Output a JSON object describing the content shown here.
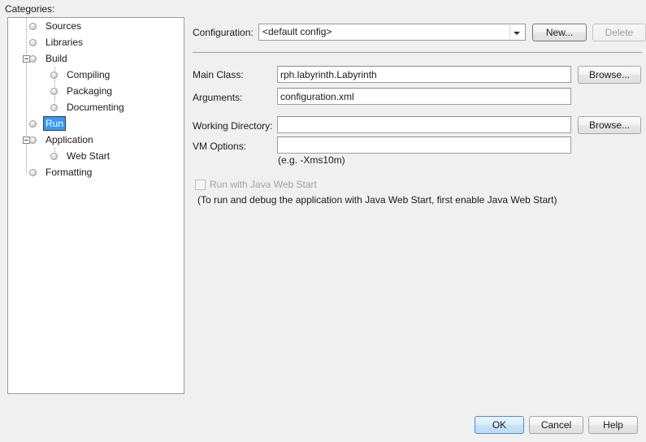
{
  "categories": {
    "label": "Categories:",
    "items": [
      {
        "label": "Sources",
        "depth": 1,
        "icon": "sphere-node-icon",
        "expander": "none",
        "selected": false
      },
      {
        "label": "Libraries",
        "depth": 1,
        "icon": "sphere-node-icon",
        "expander": "none",
        "selected": false
      },
      {
        "label": "Build",
        "depth": 1,
        "icon": "sphere-node-icon",
        "expander": "minus",
        "selected": false
      },
      {
        "label": "Compiling",
        "depth": 2,
        "icon": "sphere-node-icon",
        "expander": "none",
        "selected": false
      },
      {
        "label": "Packaging",
        "depth": 2,
        "icon": "sphere-node-icon",
        "expander": "none",
        "selected": false
      },
      {
        "label": "Documenting",
        "depth": 2,
        "icon": "sphere-node-icon",
        "expander": "none",
        "selected": false
      },
      {
        "label": "Run",
        "depth": 1,
        "icon": "sphere-node-icon",
        "expander": "none",
        "selected": true
      },
      {
        "label": "Application",
        "depth": 1,
        "icon": "sphere-node-icon",
        "expander": "minus",
        "selected": false
      },
      {
        "label": "Web Start",
        "depth": 2,
        "icon": "sphere-node-icon",
        "expander": "none",
        "selected": false
      },
      {
        "label": "Formatting",
        "depth": 1,
        "icon": "sphere-node-icon",
        "expander": "none",
        "selected": false
      }
    ]
  },
  "configuration": {
    "label": "Configuration:",
    "value": "<default config>",
    "options": [
      "<default config>"
    ],
    "dropdown_icon": "chevron-down-icon",
    "new_button": "New...",
    "delete_button": "Delete",
    "delete_enabled": false
  },
  "fields": {
    "main_class": {
      "label": "Main Class:",
      "value": "rph.labyrinth.Labyrinth",
      "placeholder": "",
      "browse_button": "Browse..."
    },
    "arguments": {
      "label": "Arguments:",
      "value": "configuration.xml",
      "placeholder": ""
    },
    "working_directory": {
      "label": "Working Directory:",
      "value": "",
      "placeholder": "",
      "browse_button": "Browse..."
    },
    "vm_options": {
      "label": "VM Options:",
      "value": "",
      "placeholder": "",
      "hint": "(e.g. -Xms10m)"
    }
  },
  "web_start": {
    "checkbox_label": "Run with Java Web Start",
    "checked": false,
    "enabled": false,
    "note": "(To run and debug the application with Java Web Start, first enable Java Web Start)"
  },
  "dialog_buttons": {
    "ok": "OK",
    "cancel": "Cancel",
    "help": "Help"
  },
  "colors": {
    "background": "#f0f0f0",
    "selection": "#3399ff",
    "field_background": "#ffffff",
    "border": "#9a9a9a",
    "default_button_border": "#4f8fd0",
    "disabled_text": "#a2a2a2"
  }
}
